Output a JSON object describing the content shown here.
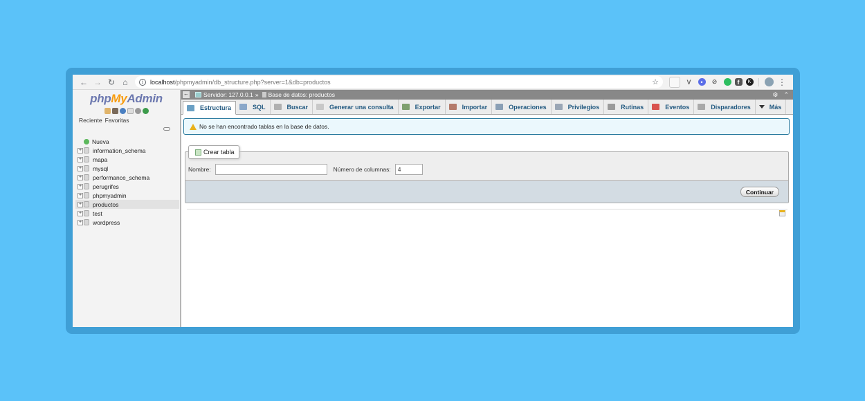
{
  "browser": {
    "url_host": "localhost",
    "url_path": "/phpmyadmin/db_structure.php?server=1&db=productos",
    "back_icon": "arrow-left-icon",
    "forward_icon": "arrow-right-icon",
    "reload_icon": "reload-icon",
    "home_icon": "home-icon",
    "star_icon": "star-icon",
    "menu_icon": "kebab-menu-icon"
  },
  "logo": {
    "php": "php",
    "my": "My",
    "admin": "Admin"
  },
  "nav": {
    "recent_label": "Reciente",
    "favorites_label": "Favoritas",
    "new_label": "Nueva",
    "databases": [
      {
        "name": "information_schema",
        "active": false
      },
      {
        "name": "mapa",
        "active": false
      },
      {
        "name": "mysql",
        "active": false
      },
      {
        "name": "performance_schema",
        "active": false
      },
      {
        "name": "perugrifes",
        "active": false
      },
      {
        "name": "phpmyadmin",
        "active": false
      },
      {
        "name": "productos",
        "active": true
      },
      {
        "name": "test",
        "active": false
      },
      {
        "name": "wordpress",
        "active": false
      }
    ]
  },
  "breadcrumb": {
    "server": "Servidor: 127.0.0.1",
    "separator": "»",
    "database": "Base de datos: productos"
  },
  "tabs": [
    {
      "label": "Estructura",
      "icon": "structure-icon",
      "color": "#6aa0c4",
      "active": true
    },
    {
      "label": "SQL",
      "icon": "sql-icon",
      "color": "#8aa7c9",
      "active": false
    },
    {
      "label": "Buscar",
      "icon": "search-icon",
      "color": "#b0b0b0",
      "active": false
    },
    {
      "label": "Generar una consulta",
      "icon": "query-icon",
      "color": "#c8c8c8",
      "active": false
    },
    {
      "label": "Exportar",
      "icon": "export-icon",
      "color": "#7fa06f",
      "active": false
    },
    {
      "label": "Importar",
      "icon": "import-icon",
      "color": "#b47a6a",
      "active": false
    },
    {
      "label": "Operaciones",
      "icon": "wrench-icon",
      "color": "#8a9fb5",
      "active": false
    },
    {
      "label": "Privilegios",
      "icon": "privileges-icon",
      "color": "#9aa6b5",
      "active": false
    },
    {
      "label": "Rutinas",
      "icon": "routines-icon",
      "color": "#9a9a9a",
      "active": false
    },
    {
      "label": "Eventos",
      "icon": "events-icon",
      "color": "#d9534f",
      "active": false
    },
    {
      "label": "Disparadores",
      "icon": "triggers-icon",
      "color": "#a9a9a9",
      "active": false
    },
    {
      "label": "Más",
      "icon": "caret-down-icon",
      "color": "#333333",
      "active": false
    }
  ],
  "notice": {
    "text": "No se han encontrado tablas en la base de datos."
  },
  "create_table": {
    "legend": "Crear tabla",
    "name_label": "Nombre:",
    "name_value": "",
    "columns_label": "Número de columnas:",
    "columns_value": "4",
    "submit_label": "Continuar"
  },
  "colors": {
    "page_bg": "#5bc2f9",
    "frame": "#3f9fd6",
    "link": "#235a81"
  }
}
